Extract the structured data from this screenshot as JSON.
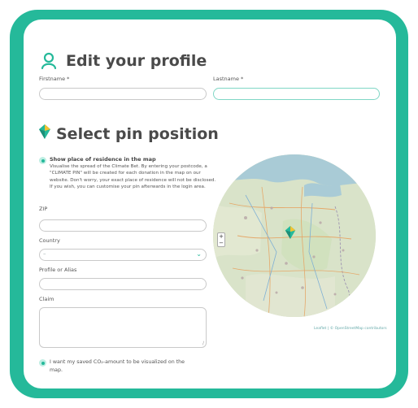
{
  "profile": {
    "title": "Edit your profile",
    "firstname_label": "Firstname *",
    "lastname_label": "Lastname *",
    "firstname_value": "",
    "lastname_value": ""
  },
  "pin": {
    "title": "Select pin position",
    "option_label": "Show place of residence in the map",
    "description": "Visualise the spread of the Climate Bet. By entering your postcode, a \"CLIMATE PIN\" will be created for each donation in the map on our website. Don't worry, your exact place of residence will not be disclosed. If you wish, you can customise your pin afterwards in the login area.",
    "zip_label": "ZIP",
    "country_label": "Country",
    "country_value": "–",
    "alias_label": "Profile or Alias",
    "claim_label": "Claim",
    "co2_label": "I want my saved CO₂-amount to be visualized on the map."
  },
  "map": {
    "zoom_in": "+",
    "zoom_out": "−",
    "attribution": "Leaflet | © OpenStreetMap contributors"
  },
  "colors": {
    "accent": "#25b99a",
    "frame": "#25b99a"
  },
  "icons": {
    "profile": "user-outline-icon",
    "pin": "map-pin-icon",
    "select": "chevron-down-icon",
    "map_marker": "climate-pin-icon"
  }
}
